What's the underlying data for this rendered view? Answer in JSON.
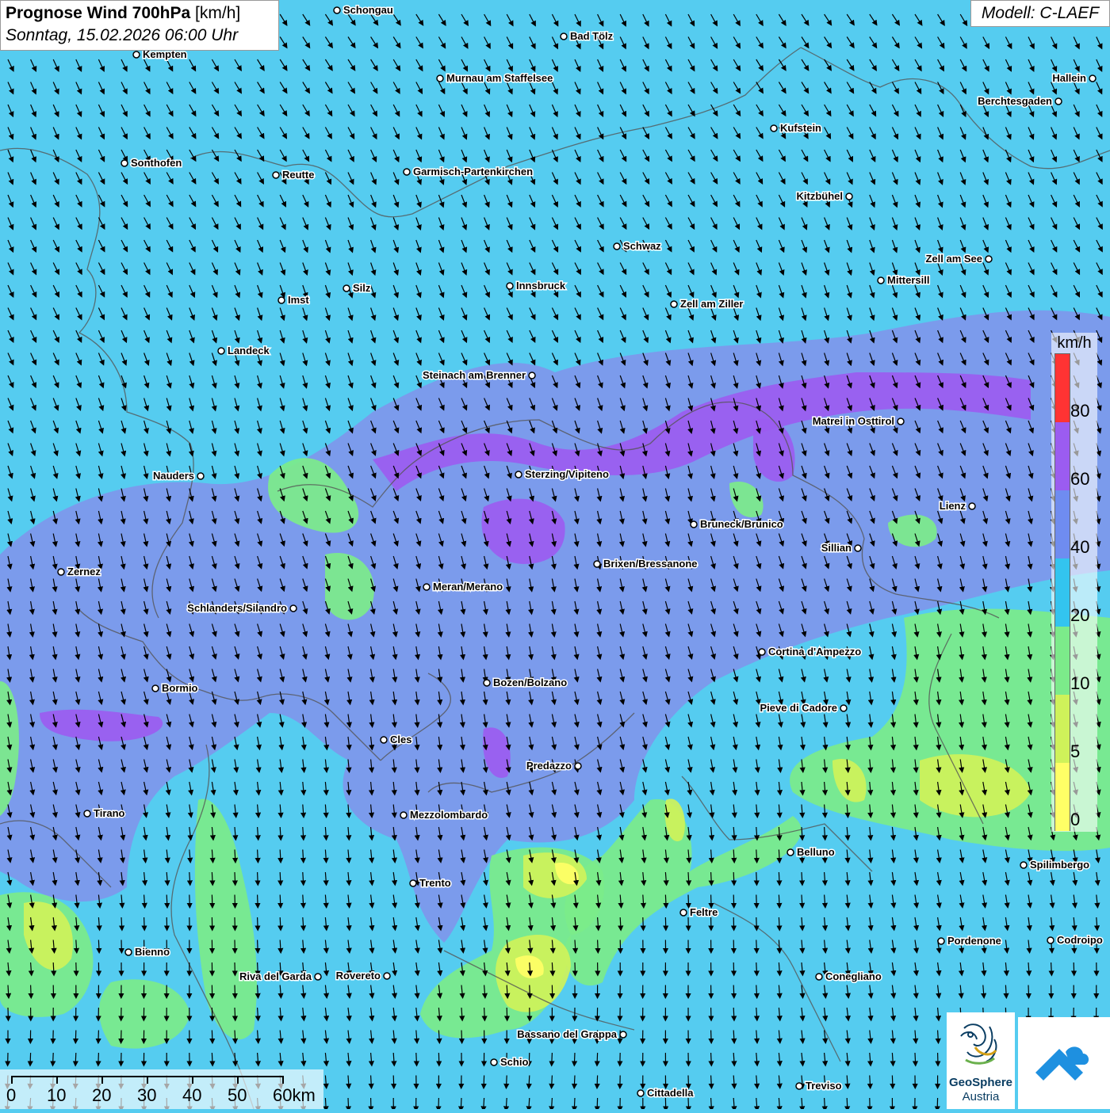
{
  "header": {
    "title_bold": "Prognose Wind 700hPa",
    "title_unit": "[km/h]",
    "datetime": "Sonntag, 15.02.2026 06:00 Uhr",
    "model": "Modell: C-LAEF"
  },
  "legend": {
    "unit": "km/h",
    "labels": [
      "80",
      "60",
      "40",
      "20",
      "10",
      "5",
      "0"
    ],
    "colors": [
      "#ff3333",
      "#9b5cf0",
      "#6f8cf0",
      "#33c4ef",
      "#7ceb8a",
      "#cff25a",
      "#ffff66"
    ]
  },
  "scale_bar": {
    "labels": [
      "0",
      "10",
      "20",
      "30",
      "40",
      "50",
      "60km"
    ]
  },
  "logo": {
    "brand": "GeoSphere",
    "sub": "Austria"
  },
  "cities": [
    "Schongau",
    "Bad Tölz",
    "Kempten",
    "Murnau am Staffelsee",
    "Hallein",
    "Berchtesgaden",
    "Kufstein",
    "Sonthofen",
    "Reutte",
    "Garmisch-Partenkirchen",
    "Kitzbühel",
    "Schwaz",
    "Zell am See",
    "Innsbruck",
    "Mittersill",
    "Silz",
    "Imst",
    "Zell am Ziller",
    "Landeck",
    "Steinach am Brenner",
    "Matrei in Osttirol",
    "Nauders",
    "Sterzing/Vipiteno",
    "Lienz",
    "Bruneck/Brunico",
    "Sillian",
    "Zernez",
    "Brixen/Bressanone",
    "Meran/Merano",
    "Schlanders/Silandro",
    "Cortina d'Ampezzo",
    "Bormio",
    "Bozen/Bolzano",
    "Pieve di Cadore",
    "Cles",
    "Predazzo",
    "Tirano",
    "Mezzolombardo",
    "Belluno",
    "Spilimbergo",
    "Trento",
    "Feltre",
    "Pordenone",
    "Codroipo",
    "Bienno",
    "Riva del Garda",
    "Rovereto",
    "Conegliano",
    "Bassano del Grappa",
    "Schio",
    "Treviso",
    "Cittadella"
  ]
}
